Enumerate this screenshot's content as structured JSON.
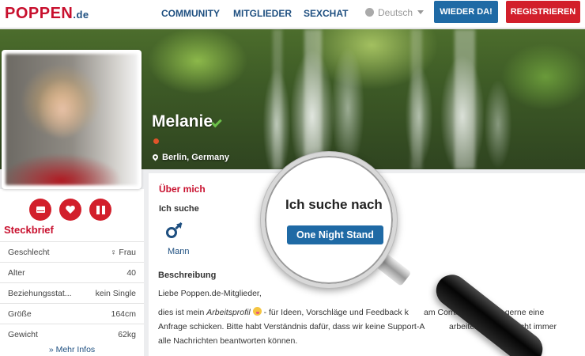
{
  "header": {
    "logo_main": "POPPEN",
    "logo_domain": ".de",
    "nav": [
      "COMMUNITY",
      "MITGLIEDER",
      "SEXCHAT"
    ],
    "language": "Deutsch",
    "login_button": "WIEDER DA!",
    "register_button": "REGISTRIEREN"
  },
  "profile": {
    "name": "Melanie",
    "location": "Berlin, Germany",
    "verified": true,
    "online_color": "#e0542a"
  },
  "steckbrief": {
    "title": "Steckbrief",
    "rows": [
      {
        "label": "Geschlecht",
        "value": "Frau",
        "icon": "female-icon"
      },
      {
        "label": "Alter",
        "value": "40"
      },
      {
        "label": "Beziehungsstat...",
        "value": "kein Single"
      },
      {
        "label": "Größe",
        "value": "164cm"
      },
      {
        "label": "Gewicht",
        "value": "62kg"
      }
    ],
    "more": "Mehr Infos"
  },
  "about": {
    "title": "Über mich",
    "seeking_label": "Ich suche",
    "seeking_value": "Mann",
    "description_title": "Beschreibung",
    "greeting": "Liebe Poppen.de-Mitglieder,",
    "text_prefix": "dies ist mein ",
    "text_italic": "Arbeitsprofil",
    "text_line1_rest": " - für Ideen, Vorschläge und Feedback k",
    "text_line1_end": "am Community-Team gerne eine",
    "text_line2_start": "Anfrage schicken. Bitte habt Verständnis dafür, dass wir keine Support-A",
    "text_line2_end": "arbeiten und ggf. nicht immer",
    "text_line3": "alle Nachrichten beantworten können."
  },
  "magnifier": {
    "heading": "Ich suche nach",
    "pill": "One Night Stand"
  },
  "colors": {
    "brand_red": "#c8102e",
    "brand_blue": "#1e4f80",
    "button_blue": "#1f6aa5",
    "button_red": "#d21f2b"
  }
}
